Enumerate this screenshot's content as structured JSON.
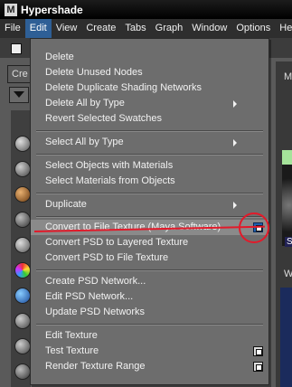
{
  "window": {
    "title": "Hypershade",
    "logo_letter": "M"
  },
  "menubar": {
    "items": [
      "File",
      "Edit",
      "View",
      "Create",
      "Tabs",
      "Graph",
      "Window",
      "Options",
      "Help"
    ],
    "active": "Edit"
  },
  "side_panel": {
    "create_tab_label": "Cre",
    "right_label_top": "M",
    "right_label_bottom": "W",
    "right_swatch_badge": "S"
  },
  "edit_menu": {
    "items": [
      {
        "label": "Delete"
      },
      {
        "label": "Delete Unused Nodes"
      },
      {
        "label": "Delete Duplicate Shading Networks"
      },
      {
        "label": "Delete All by Type",
        "submenu": true
      },
      {
        "label": "Revert Selected Swatches"
      },
      {
        "label": "Select All by Type",
        "submenu": true
      },
      {
        "label": "Select Objects with Materials"
      },
      {
        "label": "Select Materials from Objects"
      },
      {
        "label": "Duplicate",
        "submenu": true
      },
      {
        "label": "Convert to File Texture (Maya Software)",
        "option_box": true,
        "highlighted": true
      },
      {
        "label": "Convert PSD to Layered Texture"
      },
      {
        "label": "Convert PSD to File Texture"
      },
      {
        "label": "Create PSD Network..."
      },
      {
        "label": "Edit PSD Network..."
      },
      {
        "label": "Update PSD Networks"
      },
      {
        "label": "Edit Texture"
      },
      {
        "label": "Test Texture",
        "option_box": true
      },
      {
        "label": "Render Texture Range",
        "option_box": true
      }
    ]
  },
  "annotation": {
    "color": "#e21a2a"
  },
  "colors": {
    "menu_background": "#6d6d6d",
    "active_menu": "#2e5f96",
    "option_box_highlight": "#1f5fb0"
  }
}
